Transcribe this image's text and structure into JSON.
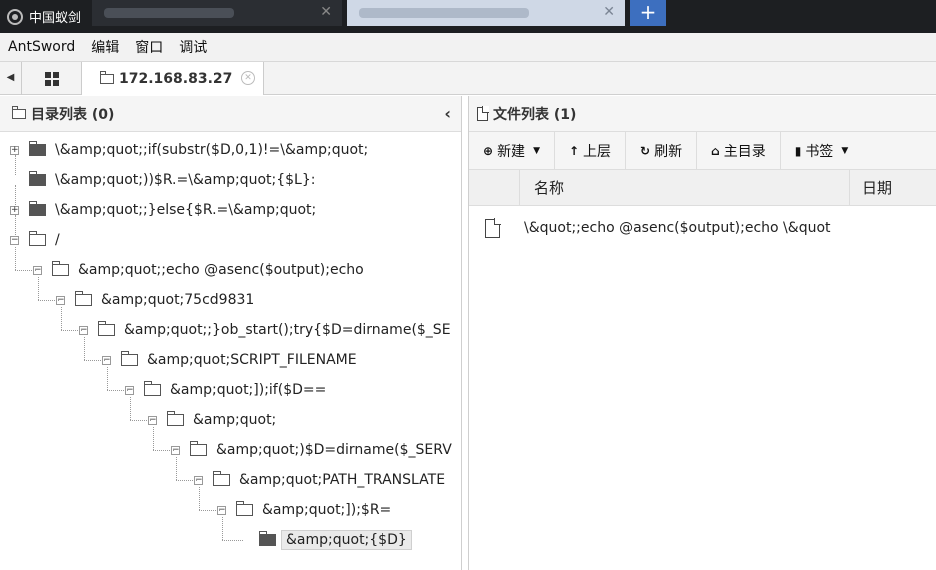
{
  "window": {
    "title": "中国蚁剑"
  },
  "browser_tabs": [
    {
      "close": "✕"
    },
    {
      "close": "✕"
    }
  ],
  "browser_new_tab": "+",
  "menu": [
    "AntSword",
    "编辑",
    "窗口",
    "调试"
  ],
  "tabstrip": {
    "tab_label": "172.168.83.27"
  },
  "left_panel": {
    "title": "目录列表 (0)",
    "tree": [
      {
        "label": "\\&amp;quot;;if(substr($D,0,1)!=\\&amp;quot;",
        "level": 0,
        "expander": "+",
        "folder": "dark"
      },
      {
        "label": "\\&amp;quot;))$R.=\\&amp;quot;{$L}:",
        "level": 0,
        "expander": "",
        "folder": "dark"
      },
      {
        "label": "\\&amp;quot;;}else{$R.=\\&amp;quot;",
        "level": 0,
        "expander": "+",
        "folder": "dark"
      },
      {
        "label": "/",
        "level": 0,
        "expander": "−",
        "folder": "open"
      },
      {
        "label": "&amp;quot;;echo @asenc($output);echo",
        "level": 1,
        "expander": "−",
        "folder": "open"
      },
      {
        "label": "&amp;quot;75cd9831",
        "level": 2,
        "expander": "−",
        "folder": "open"
      },
      {
        "label": "&amp;quot;;}ob_start();try{$D=dirname($_SE",
        "level": 3,
        "expander": "−",
        "folder": "open"
      },
      {
        "label": "&amp;quot;SCRIPT_FILENAME",
        "level": 4,
        "expander": "−",
        "folder": "open"
      },
      {
        "label": "&amp;quot;]);if($D==",
        "level": 5,
        "expander": "−",
        "folder": "open"
      },
      {
        "label": "&amp;quot;",
        "level": 6,
        "expander": "−",
        "folder": "open"
      },
      {
        "label": "&amp;quot;)$D=dirname($_SERV",
        "level": 7,
        "expander": "−",
        "folder": "open"
      },
      {
        "label": "&amp;quot;PATH_TRANSLATE",
        "level": 8,
        "expander": "−",
        "folder": "open"
      },
      {
        "label": "&amp;quot;]);$R=",
        "level": 9,
        "expander": "−",
        "folder": "open"
      },
      {
        "label": "&amp;quot;{$D}",
        "level": 10,
        "expander": "",
        "folder": "dark",
        "selected": true
      }
    ]
  },
  "right_panel": {
    "title": "文件列表 (1)",
    "toolbar": [
      {
        "icon": "plus-circle-icon",
        "glyph": "⊕",
        "label": "新建",
        "caret": "▼"
      },
      {
        "icon": "arrow-up-icon",
        "glyph": "↑",
        "label": "上层",
        "caret": ""
      },
      {
        "icon": "refresh-icon",
        "glyph": "↻",
        "label": "刷新",
        "caret": ""
      },
      {
        "icon": "home-icon",
        "glyph": "⌂",
        "label": "主目录",
        "caret": ""
      },
      {
        "icon": "bookmark-icon",
        "glyph": "▮",
        "label": "书签",
        "caret": "▼"
      }
    ],
    "columns": [
      "名称",
      "日期"
    ],
    "files": [
      {
        "name": "\\&quot;;echo @asenc($output);echo \\&quot"
      }
    ]
  },
  "colors": {
    "titlebar": "#1d1f22",
    "active_tab": "#3d6fbf",
    "selected_node": "#eaeaea"
  }
}
